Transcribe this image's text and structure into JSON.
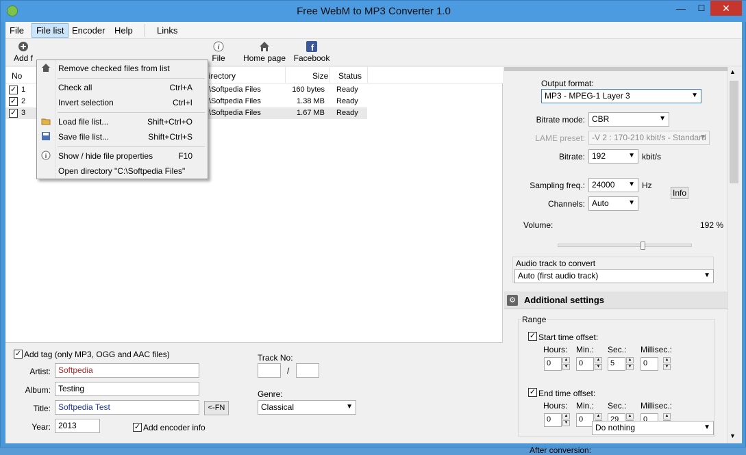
{
  "title": "Free WebM to MP3 Converter 1.0",
  "window_buttons": {
    "minimize": "—",
    "maximize": "☐",
    "close": "✕"
  },
  "menubar": {
    "file": "File",
    "file_list": "File list",
    "encoder": "Encoder",
    "help": "Help",
    "links": "Links"
  },
  "toolbar": {
    "add": "Add f",
    "file": "File",
    "home": "Home page",
    "facebook": "Facebook"
  },
  "list_headers": {
    "no": "No",
    "directory": "Directory",
    "size": "Size",
    "status": "Status"
  },
  "files": [
    {
      "no": "1",
      "directory": "C:\\Softpedia Files",
      "size": "160 bytes",
      "status": "Ready"
    },
    {
      "no": "2",
      "directory": "C:\\Softpedia Files",
      "size": "1.38 MB",
      "status": "Ready"
    },
    {
      "no": "3",
      "directory": "C:\\Softpedia Files",
      "size": "1.67 MB",
      "status": "Ready"
    }
  ],
  "file_list_menu": {
    "remove": "Remove checked files from list",
    "check_all": "Check all",
    "check_all_key": "Ctrl+A",
    "invert": "Invert selection",
    "invert_key": "Ctrl+I",
    "load": "Load file list...",
    "load_key": "Shift+Ctrl+O",
    "save": "Save file list...",
    "save_key": "Shift+Ctrl+S",
    "props": "Show / hide file properties",
    "props_key": "F10",
    "open_dir": "Open directory \"C:\\Softpedia Files\""
  },
  "tags": {
    "add_tag": "Add tag (only MP3, OGG and AAC files)",
    "artist_label": "Artist:",
    "artist": "Softpedia",
    "album_label": "Album:",
    "album": "Testing",
    "title_label": "Title:",
    "title": "Softpedia Test",
    "fn_button": "<-FN",
    "year_label": "Year:",
    "year": "2013",
    "encoder_info": "Add encoder info",
    "track_label": "Track No:",
    "track_sep": "/",
    "genre_label": "Genre:",
    "genre": "Classical"
  },
  "settings": {
    "output_format_label": "Output format:",
    "output_format": "MP3 - MPEG-1 Layer 3",
    "bitrate_mode_label": "Bitrate mode:",
    "bitrate_mode": "CBR",
    "lame_label": "LAME preset:",
    "lame": "-V 2 : 170-210 kbit/s - Standard",
    "bitrate_label": "Bitrate:",
    "bitrate": "192",
    "bitrate_unit": "kbit/s",
    "sampling_label": "Sampling freq.:",
    "sampling": "24000",
    "sampling_unit": "Hz",
    "info_button": "Info",
    "channels_label": "Channels:",
    "channels": "Auto",
    "volume_label": "Volume:",
    "volume": "192 %",
    "audio_track_label": "Audio track to convert",
    "audio_track": "Auto (first audio track)"
  },
  "additional": {
    "header": "Additional settings",
    "range": "Range",
    "start_label": "Start time offset:",
    "end_label": "End time offset:",
    "hours": "Hours:",
    "min": "Min.:",
    "sec": "Sec.:",
    "millisec": "Millisec.:",
    "start": {
      "hours": "0",
      "min": "0",
      "sec": "5",
      "ms": "0"
    },
    "end": {
      "hours": "0",
      "min": "0",
      "sec": "29",
      "ms": "0"
    },
    "after_label": "After conversion:",
    "after": "Do nothing"
  }
}
